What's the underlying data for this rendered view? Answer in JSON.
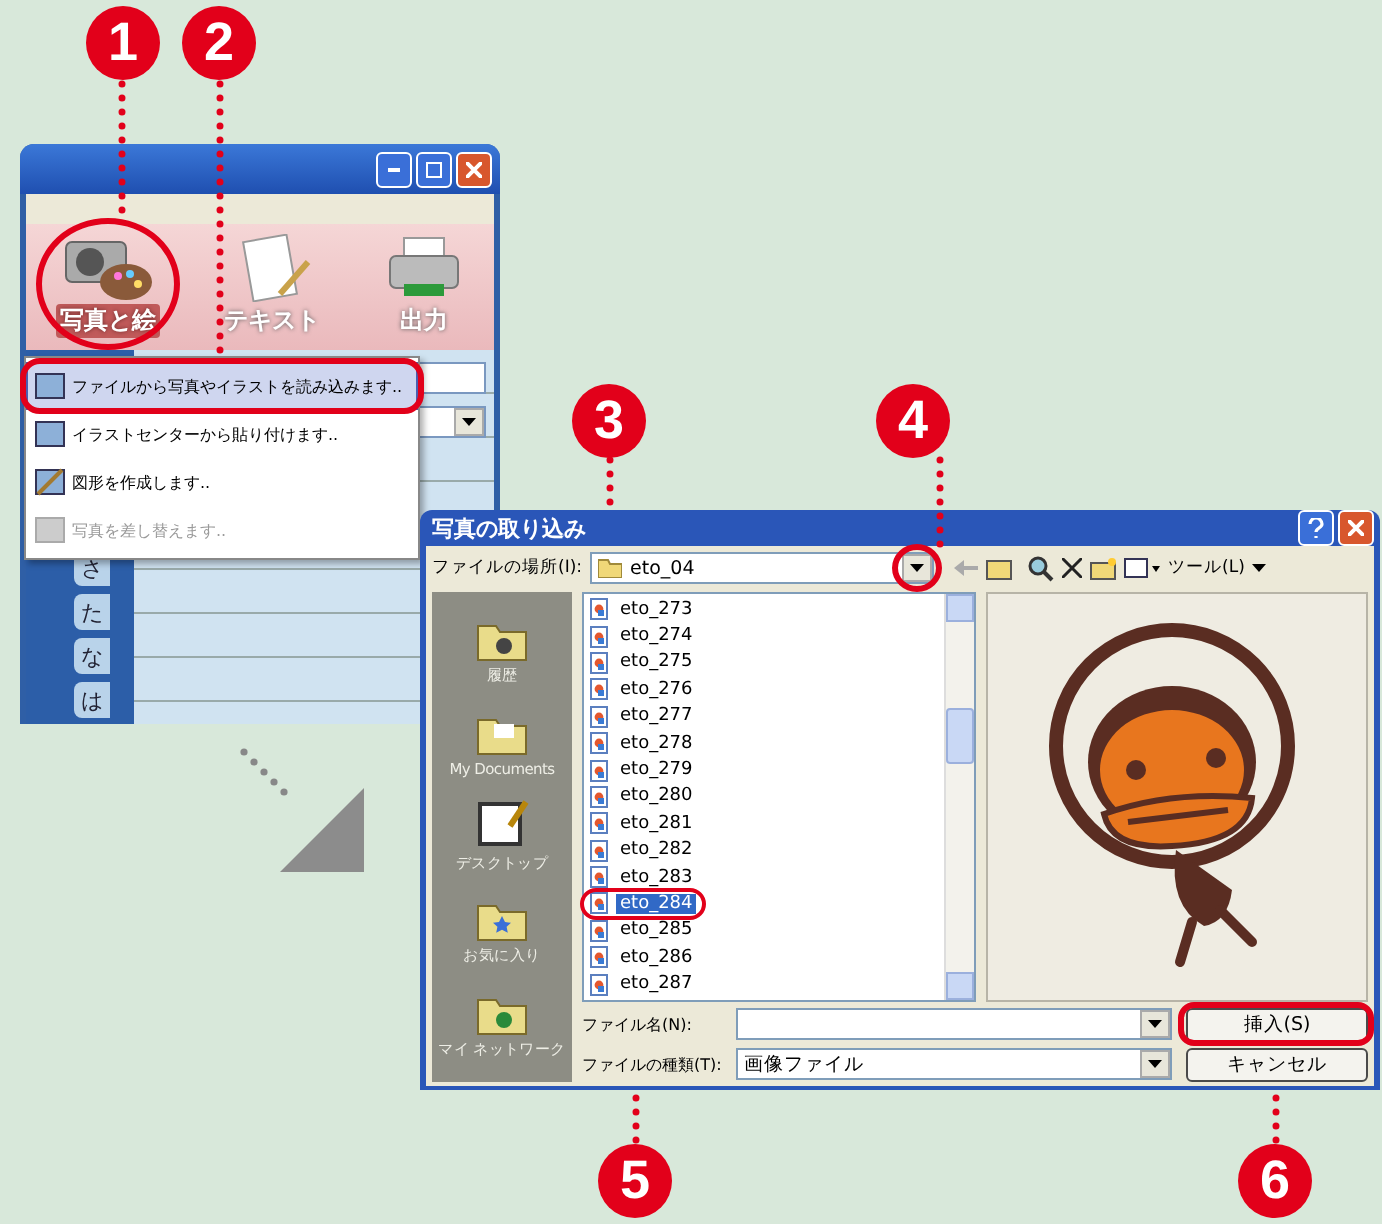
{
  "markers": [
    {
      "label": "1"
    },
    {
      "label": "2"
    },
    {
      "label": "3"
    },
    {
      "label": "4"
    },
    {
      "label": "5"
    },
    {
      "label": "6"
    }
  ],
  "app_window": {
    "tools": [
      {
        "label": "写真と絵",
        "selected": true
      },
      {
        "label": "テキスト",
        "selected": false
      },
      {
        "label": "出力",
        "selected": false
      }
    ],
    "menu": [
      {
        "label": "ファイルから写真やイラストを読み込みます..",
        "selected": true,
        "disabled": false
      },
      {
        "label": "イラストセンターから貼り付けます..",
        "selected": false,
        "disabled": false
      },
      {
        "label": "図形を作成します..",
        "selected": false,
        "disabled": false
      },
      {
        "label": "写真を差し替えます..",
        "selected": false,
        "disabled": true
      }
    ],
    "index_tabs": [
      "さ",
      "た",
      "な",
      "は"
    ]
  },
  "dialog": {
    "title": "写真の取り込み",
    "location_label": "ファイルの場所(I):",
    "location": "eto_04",
    "tools_menu": "ツール(L)",
    "places": [
      {
        "label": "履歴",
        "kind": "history"
      },
      {
        "label": "My Documents",
        "kind": "documents"
      },
      {
        "label": "デスクトップ",
        "kind": "desktop"
      },
      {
        "label": "お気に入り",
        "kind": "favorites"
      },
      {
        "label": "マイ ネットワーク",
        "kind": "network"
      }
    ],
    "files": [
      {
        "name": "eto_273",
        "selected": false
      },
      {
        "name": "eto_274",
        "selected": false
      },
      {
        "name": "eto_275",
        "selected": false
      },
      {
        "name": "eto_276",
        "selected": false
      },
      {
        "name": "eto_277",
        "selected": false
      },
      {
        "name": "eto_278",
        "selected": false
      },
      {
        "name": "eto_279",
        "selected": false
      },
      {
        "name": "eto_280",
        "selected": false
      },
      {
        "name": "eto_281",
        "selected": false
      },
      {
        "name": "eto_282",
        "selected": false
      },
      {
        "name": "eto_283",
        "selected": false
      },
      {
        "name": "eto_284",
        "selected": true
      },
      {
        "name": "eto_285",
        "selected": false
      },
      {
        "name": "eto_286",
        "selected": false
      },
      {
        "name": "eto_287",
        "selected": false
      }
    ],
    "file_name_label": "ファイル名(N):",
    "file_type_label": "ファイルの種類(T):",
    "file_type": "画像ファイル",
    "buttons": [
      "挿入(S)",
      "キャンセル"
    ]
  }
}
